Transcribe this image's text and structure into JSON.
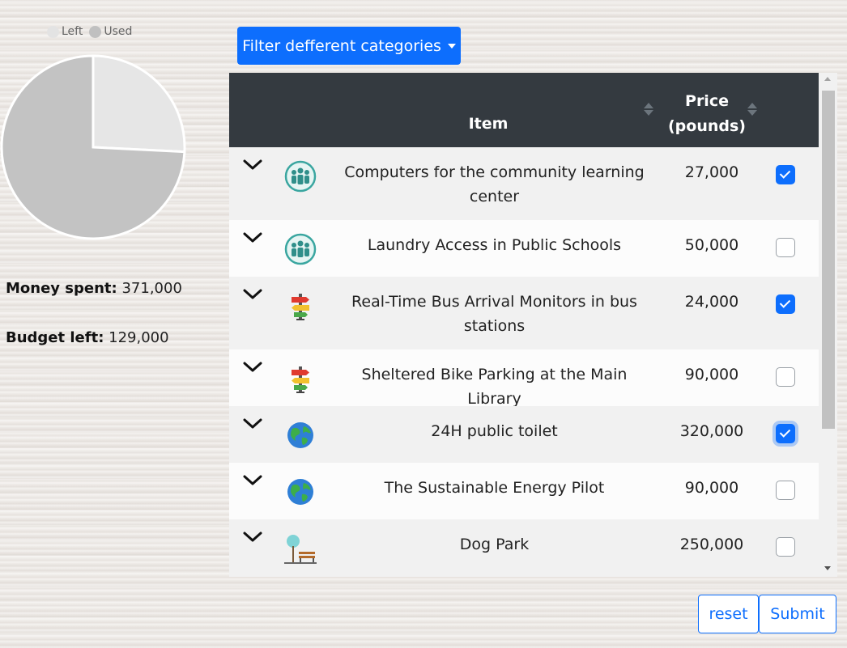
{
  "legend": [
    {
      "label": "Left",
      "color": "#e3e3e3"
    },
    {
      "label": "Used",
      "color": "#c0c0c0"
    }
  ],
  "chart_data": {
    "type": "pie",
    "categories": [
      "Left",
      "Used"
    ],
    "values": [
      129000,
      371000
    ],
    "colors": [
      "#e6e6e6",
      "#c3c3c3"
    ],
    "legend_position": "top"
  },
  "summary": {
    "spent_label": "Money spent:",
    "spent_value": "371,000",
    "left_label": "Budget left:",
    "left_value": "129,000"
  },
  "filter": {
    "label": "Filter defferent categories"
  },
  "table": {
    "headers": {
      "item": "Item",
      "price_line1": "Price",
      "price_line2": "(pounds)"
    },
    "rows": [
      {
        "name": "Computers for the community learning center",
        "price": "27,000",
        "checked": true,
        "icon": "community-icon"
      },
      {
        "name": "Laundry Access in Public Schools",
        "price": "50,000",
        "checked": false,
        "icon": "community-icon"
      },
      {
        "name": "Real-Time Bus Arrival Monitors in bus stations",
        "price": "24,000",
        "checked": true,
        "icon": "signpost-icon"
      },
      {
        "name": "Sheltered Bike Parking at the Main Library",
        "price": "90,000",
        "checked": false,
        "icon": "signpost-icon"
      },
      {
        "name": "24H public toilet",
        "price": "320,000",
        "checked": true,
        "icon": "globe-icon"
      },
      {
        "name": "The Sustainable Energy Pilot",
        "price": "90,000",
        "checked": false,
        "icon": "globe-icon"
      },
      {
        "name": "Dog Park",
        "price": "250,000",
        "checked": false,
        "icon": "park-bench-icon"
      }
    ]
  },
  "buttons": {
    "reset": "reset",
    "submit": "Submit"
  }
}
